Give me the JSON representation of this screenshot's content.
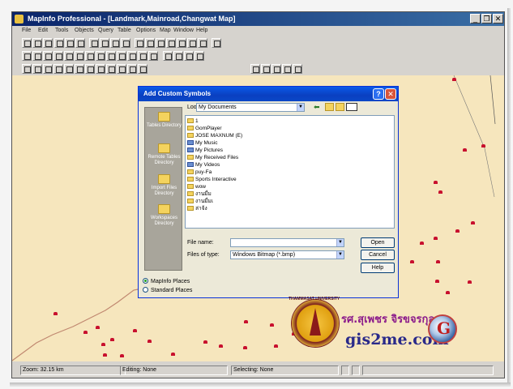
{
  "window": {
    "title": "MapInfo Professional - [Landmark,Mainroad,Changwat Map]",
    "controls": [
      "_",
      "❐",
      "✕"
    ]
  },
  "menu": [
    "File",
    "Edit",
    "Tools",
    "Objects",
    "Query",
    "Table",
    "Options",
    "Map",
    "Window",
    "Help"
  ],
  "dialog": {
    "title": "Add Custom Symbols",
    "look_in_label": "Look in:",
    "look_in_value": "My Documents",
    "places": [
      {
        "label": "Tables Directory"
      },
      {
        "label": "Remote Tables Directory"
      },
      {
        "label": "Import Files Directory"
      },
      {
        "label": "Workspaces Directory"
      }
    ],
    "files": [
      {
        "name": "1",
        "type": "folder"
      },
      {
        "name": "GomPlayer",
        "type": "folder"
      },
      {
        "name": "JOSE MAXNUM (E)",
        "type": "folder"
      },
      {
        "name": "My Music",
        "type": "system"
      },
      {
        "name": "My Pictures",
        "type": "system"
      },
      {
        "name": "My Received Files",
        "type": "folder"
      },
      {
        "name": "My Videos",
        "type": "system"
      },
      {
        "name": "puy-Fa",
        "type": "folder"
      },
      {
        "name": "Sports Interactive",
        "type": "folder"
      },
      {
        "name": "wow",
        "type": "folder"
      },
      {
        "name": "งานมื่ม",
        "type": "folder"
      },
      {
        "name": "งานมื่มเ",
        "type": "folder"
      },
      {
        "name": "ล่าจ้ง",
        "type": "folder"
      }
    ],
    "file_name_label": "File name:",
    "file_name_value": "",
    "files_of_type_label": "Files of type:",
    "files_of_type_value": "Windows Bitmap (*.bmp)",
    "open_label": "Open",
    "cancel_label": "Cancel",
    "help_label": "Help",
    "radio_mapinfo": "MapInfo Places",
    "radio_standard": "Standard Places",
    "radio_selected": "mapinfo"
  },
  "status": {
    "zoom": "Zoom: 32.15 km",
    "editing": "Editing: None",
    "selecting": "Selecting: None"
  },
  "branding": {
    "thai_name": "รศ.สุเพชร จิรขจรกุล",
    "url": "gis2me.com",
    "seal_text": "THAMMASAT UNIVERSITY",
    "globe_letter": "G"
  },
  "colors": {
    "map_background": "#f6e6bd",
    "symbol": "#c8102e",
    "titlebar": "#0a246a",
    "dialog_titlebar": "#0a5ae8"
  }
}
